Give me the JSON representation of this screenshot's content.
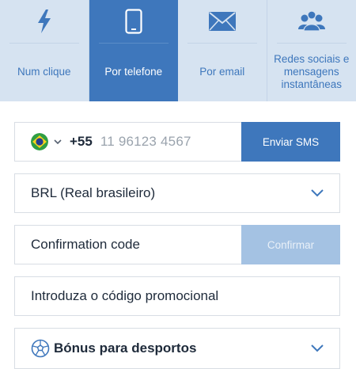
{
  "tabs": [
    {
      "label": "Num clique",
      "icon": "lightning-icon",
      "active": false
    },
    {
      "label": "Por telefone",
      "icon": "phone-icon",
      "active": true
    },
    {
      "label": "Por email",
      "icon": "envelope-icon",
      "active": false
    },
    {
      "label": "Redes sociais e mensagens instantâneas",
      "icon": "people-icon",
      "active": false
    }
  ],
  "phone": {
    "country_flag": "brazil-flag-icon",
    "country_code": "+55",
    "placeholder": "11 96123 4567",
    "send_sms_label": "Enviar SMS"
  },
  "currency": {
    "selected": "BRL (Real brasileiro)"
  },
  "confirmation": {
    "placeholder": "Confirmation code",
    "confirm_label": "Confirmar"
  },
  "promo": {
    "placeholder": "Introduza o código promocional"
  },
  "bonus": {
    "selected": "Bónus para desportos",
    "icon": "soccer-ball-icon"
  },
  "colors": {
    "accent": "#3e77bc",
    "tab_bg": "#d6e3f1",
    "disabled_button": "#a4c2e3",
    "text": "#1e2a3a"
  }
}
